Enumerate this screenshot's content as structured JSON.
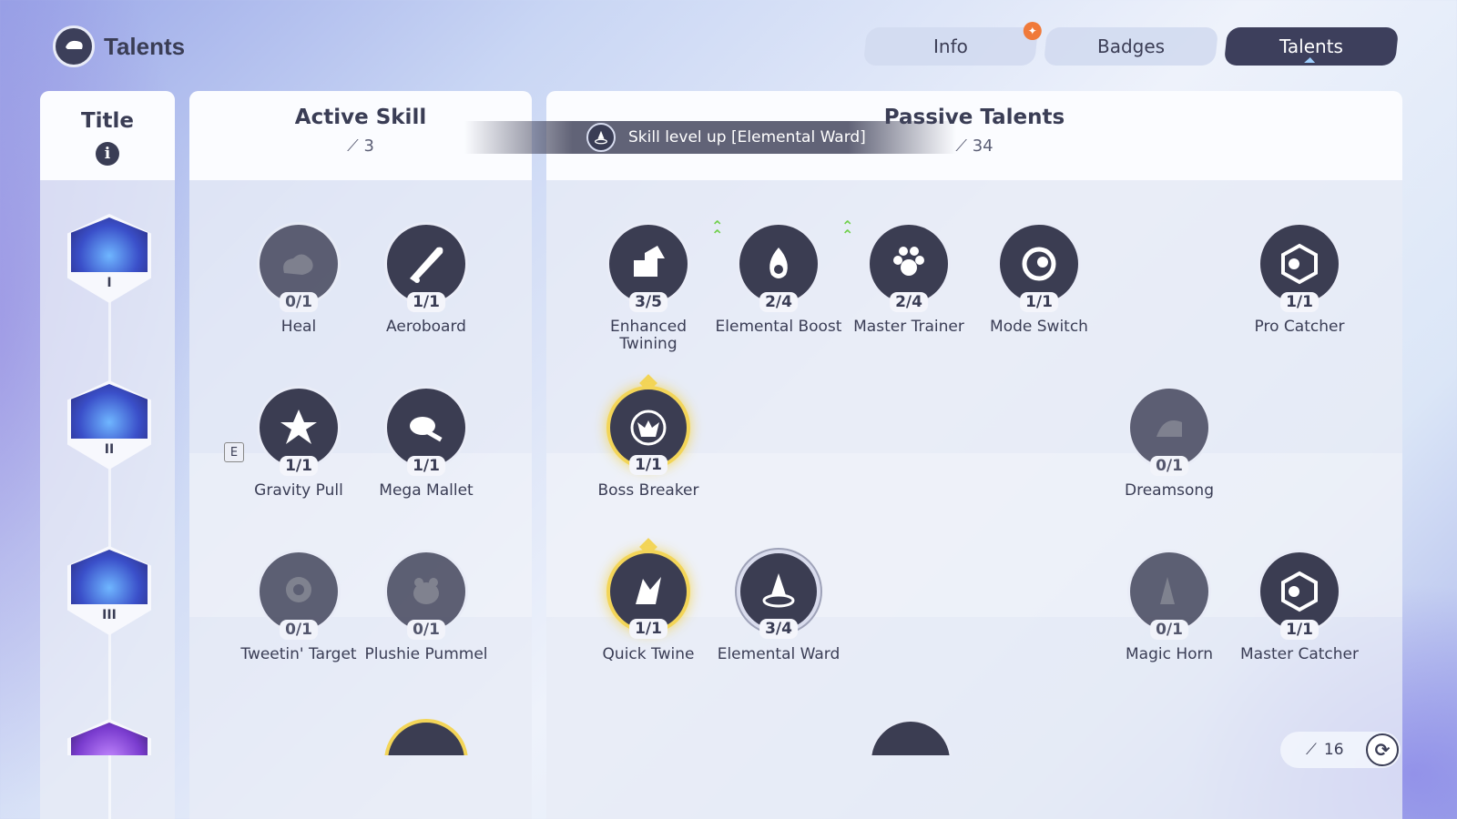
{
  "header": {
    "title": "Talents"
  },
  "tabs": [
    {
      "label": "Info",
      "active": false,
      "badge": "gift-icon"
    },
    {
      "label": "Badges",
      "active": false
    },
    {
      "label": "Talents",
      "active": true
    }
  ],
  "columns": {
    "title": {
      "label": "Title"
    },
    "active": {
      "label": "Active Skill",
      "points": "3"
    },
    "passive": {
      "label": "Passive Talents",
      "points": "34"
    }
  },
  "notification": {
    "text": "Skill level up  [Elemental Ward]"
  },
  "title_emblems": [
    "I",
    "II",
    "III"
  ],
  "active_skills": [
    {
      "label": "Heal",
      "level": "0/1"
    },
    {
      "label": "Aeroboard",
      "level": "1/1"
    },
    {
      "label": "Gravity Pull",
      "level": "1/1",
      "key": "E"
    },
    {
      "label": "Mega Mallet",
      "level": "1/1"
    },
    {
      "label": "Tweetin' Target",
      "level": "0/1"
    },
    {
      "label": "Plushie Pummel",
      "level": "0/1"
    }
  ],
  "passive_talents": [
    {
      "label": "Enhanced Twining",
      "level": "3/5"
    },
    {
      "label": "Elemental Boost",
      "level": "2/4",
      "upgradable": true
    },
    {
      "label": "Master Trainer",
      "level": "2/4",
      "upgradable": true
    },
    {
      "label": "Mode Switch",
      "level": "1/1"
    },
    {
      "label": "Pro Catcher",
      "level": "1/1"
    },
    {
      "label": "Boss Breaker",
      "level": "1/1"
    },
    {
      "label": "Dreamsong",
      "level": "0/1"
    },
    {
      "label": "Quick Twine",
      "level": "1/1"
    },
    {
      "label": "Elemental Ward",
      "level": "3/4"
    },
    {
      "label": "Magic Horn",
      "level": "0/1"
    },
    {
      "label": "Master Catcher",
      "level": "1/1"
    }
  ],
  "footer": {
    "remaining_points": "16"
  },
  "colors": {
    "node": "#3b3d52",
    "gold": "#f3d558",
    "upgrade": "#6fcf4a",
    "tab_active": "#3d3f5c"
  }
}
